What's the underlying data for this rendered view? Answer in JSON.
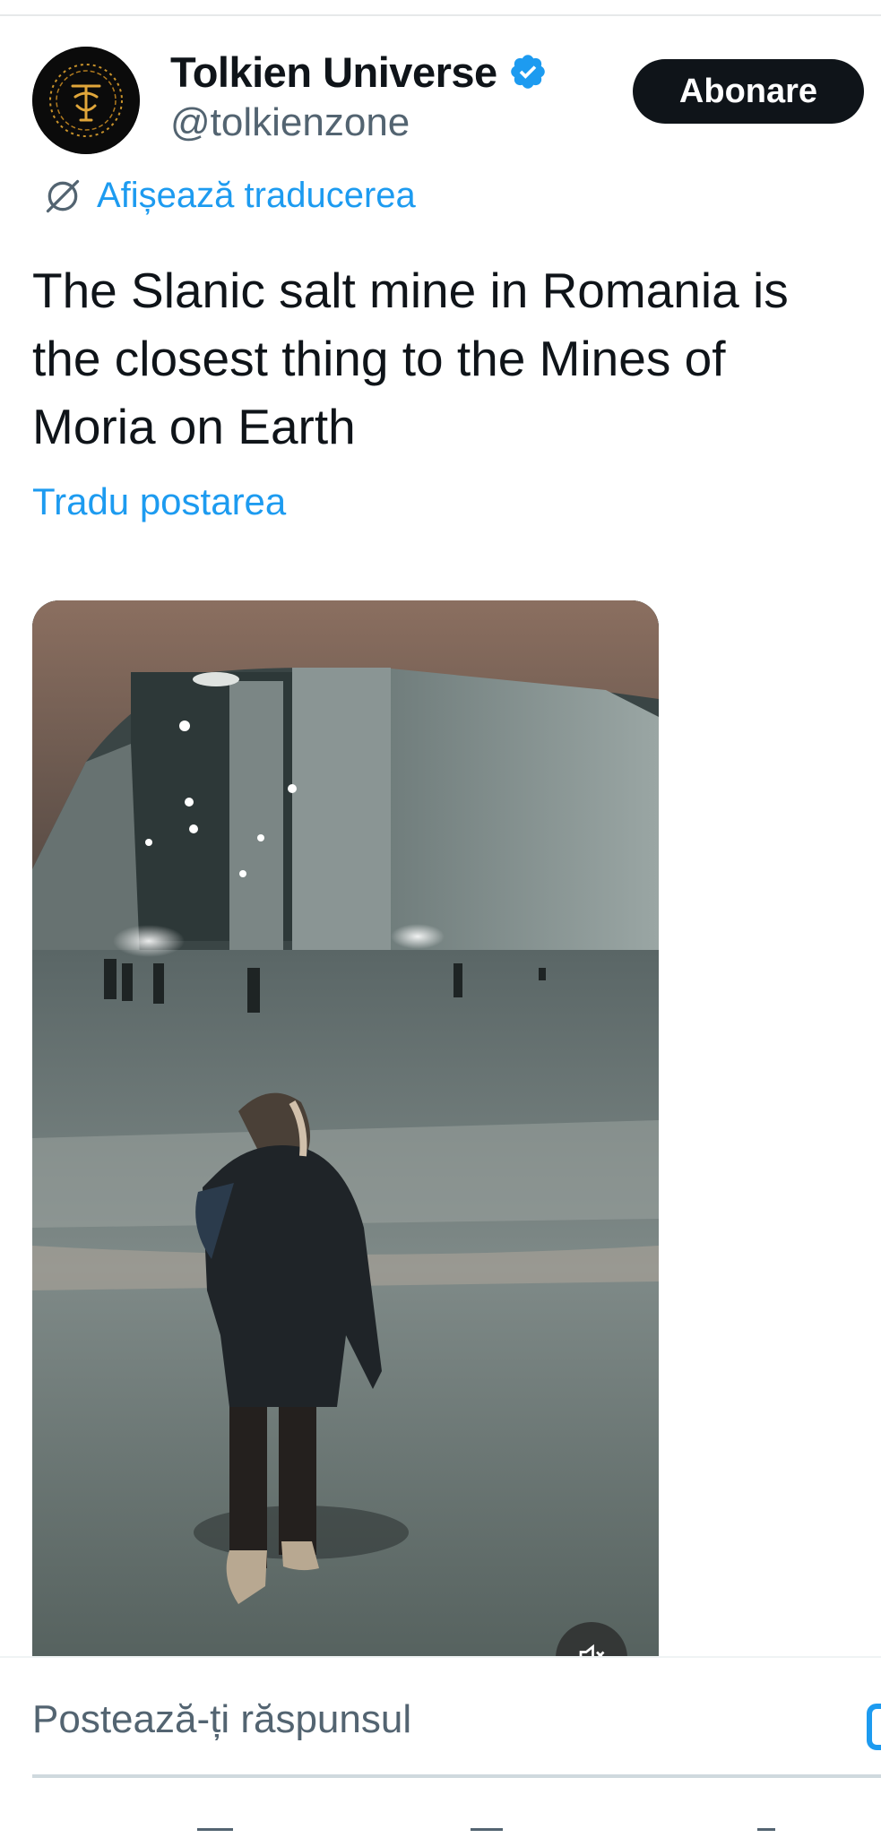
{
  "post": {
    "author": {
      "display_name": "Tolkien Universe",
      "handle": "@tolkienzone",
      "verified": true
    },
    "subscribe_label": "Abonare",
    "show_translation_label": "Afișează traducerea",
    "text": "The Slanic salt mine in Romania is the closest thing to the Mines of Moria on Earth",
    "translate_post_label": "Tradu postarea",
    "media": {
      "type": "video",
      "muted": true
    }
  },
  "reply": {
    "placeholder": "Postează-ți răspunsul"
  },
  "icons": {
    "verified": "verified-badge-icon",
    "translation": "globe-slash-icon",
    "mute": "speaker-muted-icon",
    "image": "image-icon"
  },
  "colors": {
    "accent": "#1d9bf0",
    "primary_text": "#0f1419",
    "secondary_text": "#536471",
    "button_bg": "#0f1419"
  }
}
